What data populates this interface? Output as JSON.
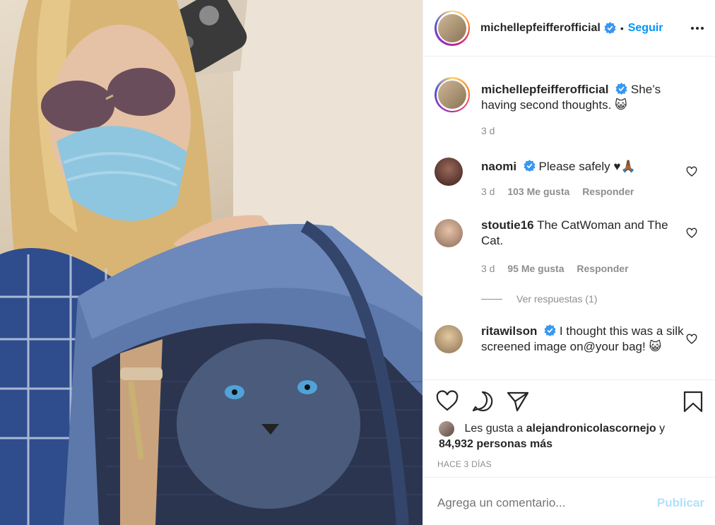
{
  "post": {
    "author": "michellepfeifferofficial",
    "follow_label": "Seguir",
    "dot": "•",
    "caption_text": "She’s having second thoughts. 😺",
    "caption_time": "3 d"
  },
  "comments": [
    {
      "user": "naomi",
      "text": "Please safely ♥🙏🏾",
      "time": "3 d",
      "likes": "103 Me gusta",
      "reply": "Responder"
    },
    {
      "user": "stoutie16",
      "text": "The CatWoman and The Cat.",
      "time": "3 d",
      "likes": "95 Me gusta",
      "reply": "Responder"
    },
    {
      "user": "ritawilson",
      "text": "I thought this was a silk screened image on@your bag! 😺"
    }
  ],
  "view_replies": "Ver respuestas (1)",
  "likes": {
    "prefix": "Les gusta a",
    "user": "alejandronicolascornejo",
    "conj": "y",
    "count": "84,932 personas más"
  },
  "timestamp": "HACE 3 DÍAS",
  "add_comment": {
    "placeholder": "Agrega un comentario...",
    "post_label": "Publicar"
  },
  "colors": {
    "accent": "#0095f6",
    "verified": "#3897f0",
    "muted": "#8e8e8e",
    "post_disabled": "#b2dffc"
  },
  "icons": [
    "verified-badge-icon",
    "more-options-icon",
    "heart-icon",
    "comment-icon",
    "share-icon",
    "bookmark-icon"
  ]
}
